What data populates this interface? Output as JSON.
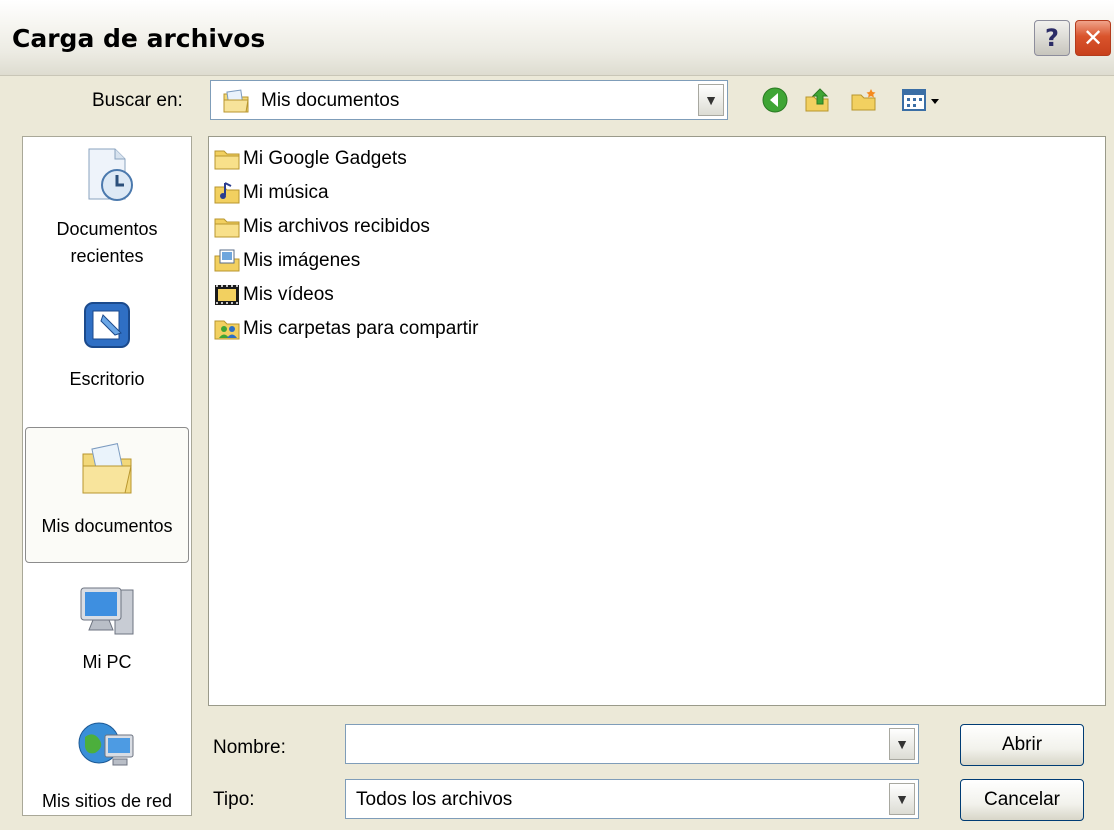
{
  "window": {
    "title": "Carga de archivos",
    "help_glyph": "?",
    "close_glyph": "✕"
  },
  "lookin": {
    "label": "Buscar en:",
    "value": "Mis documentos"
  },
  "toolbar": {
    "icons": [
      "back-icon",
      "up-folder-icon",
      "new-folder-icon",
      "view-menu-icon"
    ]
  },
  "places": [
    {
      "label_l1": "Documentos",
      "label_l2": "recientes",
      "icon": "recent-documents-icon"
    },
    {
      "label": "Escritorio",
      "icon": "desktop-icon"
    },
    {
      "label": "Mis documentos",
      "icon": "my-documents-icon",
      "selected": true
    },
    {
      "label": "Mi PC",
      "icon": "my-computer-icon"
    },
    {
      "label": "Mis sitios de red",
      "icon": "network-places-icon"
    }
  ],
  "files": [
    {
      "name": "Mi Google Gadgets",
      "icon": "folder-icon"
    },
    {
      "name": "Mi música",
      "icon": "music-folder-icon"
    },
    {
      "name": "Mis archivos recibidos",
      "icon": "folder-icon"
    },
    {
      "name": "Mis imágenes",
      "icon": "pictures-folder-icon"
    },
    {
      "name": "Mis vídeos",
      "icon": "videos-folder-icon"
    },
    {
      "name": "Mis carpetas para compartir",
      "icon": "shared-folder-icon"
    }
  ],
  "filename": {
    "label": "Nombre:",
    "value": ""
  },
  "filetype": {
    "label": "Tipo:",
    "value": "Todos los archivos"
  },
  "buttons": {
    "open": "Abrir",
    "cancel": "Cancelar"
  },
  "colors": {
    "dialog_bg": "#ece9d8",
    "field_border": "#7f9db9",
    "close_red": "#d9542c"
  }
}
